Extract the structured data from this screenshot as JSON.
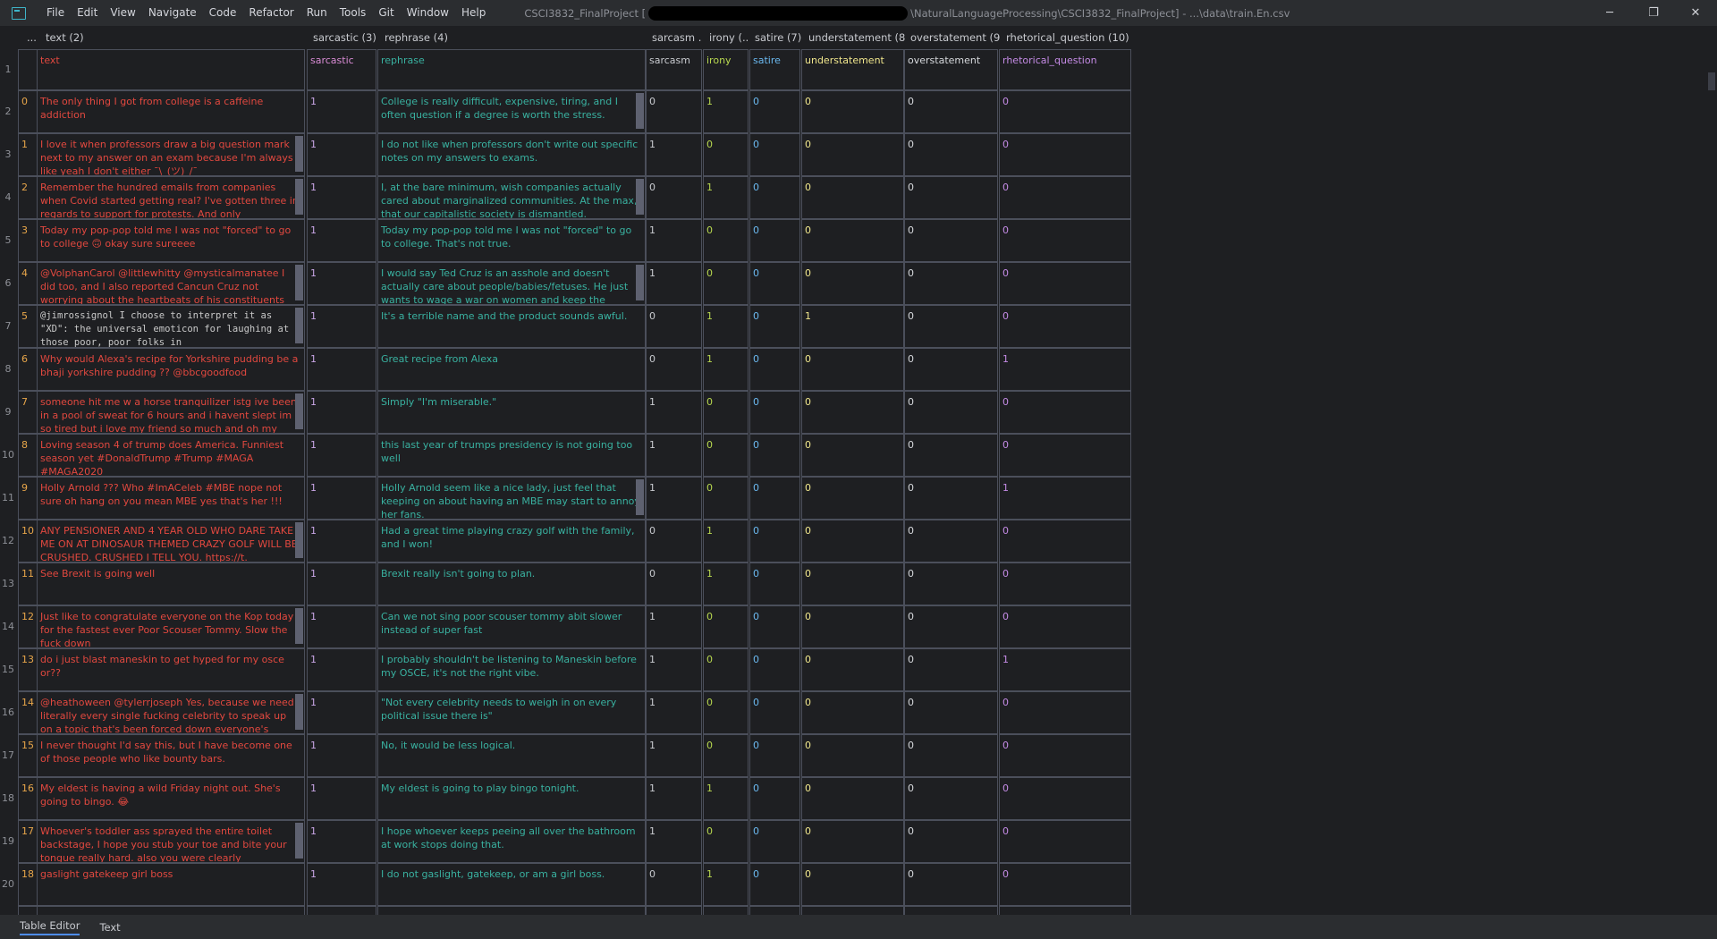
{
  "title": {
    "project": "CSCI3832_FinalProject [",
    "path_tail": "\\NaturalLanguageProcessing\\CSCI3832_FinalProject] - ...\\data\\train.En.csv"
  },
  "menu": [
    "File",
    "Edit",
    "View",
    "Navigate",
    "Code",
    "Refactor",
    "Run",
    "Tools",
    "Git",
    "Window",
    "Help"
  ],
  "window_controls": {
    "minimize": "─",
    "restore": "❐",
    "close": "✕"
  },
  "columns": {
    "corner": "...",
    "text": "text (2)",
    "sarcastic": "sarcastic (3)",
    "rephrase": "rephrase (4)",
    "sarcasm": "sarcasm ...",
    "irony": "irony (...",
    "satire": "satire (7)",
    "understatement": "understatement (8)",
    "overstatement": "overstatement (9)",
    "rhetorical_question": "rhetorical_question (10)"
  },
  "header_row": {
    "rownum": "1",
    "text": "text",
    "sarcastic": "sarcastic",
    "rephrase": "rephrase",
    "sarcasm": "sarcasm",
    "irony": "irony",
    "satire": "satire",
    "understatement": "understatement",
    "overstatement": "overstatement",
    "rhetorical_question": "rhetorical_question"
  },
  "rows": [
    {
      "rownum": "2",
      "idx": "0",
      "text": "The only thing I got from college is a caffeine addiction",
      "sarcastic": "1",
      "rephrase": "College is really difficult, expensive, tiring, and I often question if a degree is worth the stress.",
      "sarcasm": "0",
      "irony": "1",
      "satire": "0",
      "understatement": "0",
      "overstatement": "0",
      "rhetorical_question": "0"
    },
    {
      "rownum": "3",
      "idx": "1",
      "text": "I love it when professors draw a big question mark next to my answer on an exam because I'm always like yeah I don't either ¯\\_(ツ)_/¯",
      "sarcastic": "1",
      "rephrase": "I do not like when professors don't write out specific notes on my answers to exams.",
      "sarcasm": "1",
      "irony": "0",
      "satire": "0",
      "understatement": "0",
      "overstatement": "0",
      "rhetorical_question": "0"
    },
    {
      "rownum": "4",
      "idx": "2",
      "text": "Remember the hundred emails from companies when Covid started getting real? I've gotten three in regards to support for protests. And only",
      "sarcastic": "1",
      "rephrase": "I, at the bare minimum, wish companies actually cared about marginalized communities. At the max, that our capitalistic society is dismantled.",
      "sarcasm": "0",
      "irony": "1",
      "satire": "0",
      "understatement": "0",
      "overstatement": "0",
      "rhetorical_question": "0"
    },
    {
      "rownum": "5",
      "idx": "3",
      "text": "Today my pop-pop told me I was not \"forced\" to go to college 🙃 okay sure sureeee",
      "sarcastic": "1",
      "rephrase": "Today my pop-pop told me I was not \"forced\" to go to college. That's not true.",
      "sarcasm": "1",
      "irony": "0",
      "satire": "0",
      "understatement": "0",
      "overstatement": "0",
      "rhetorical_question": "0"
    },
    {
      "rownum": "6",
      "idx": "4",
      "text": "@VolphanCarol @littlewhitty @mysticalmanatee I did too, and I also reported Cancun Cruz not worrying about the heartbeats of his constituents",
      "sarcastic": "1",
      "rephrase": "I would say Ted Cruz is an asshole and doesn't actually care about people/babies/fetuses. He just wants to wage a war on women and keep the",
      "sarcasm": "1",
      "irony": "0",
      "satire": "0",
      "understatement": "0",
      "overstatement": "0",
      "rhetorical_question": "0"
    },
    {
      "rownum": "7",
      "idx": "5",
      "text": "@jimrossignol I choose to interpret it as \"XD\": the universal emoticon for laughing at those poor, poor folks in",
      "mono": true,
      "sarcastic": "1",
      "rephrase": "It's a terrible name and the product sounds awful.",
      "sarcasm": "0",
      "irony": "1",
      "satire": "0",
      "understatement": "1",
      "overstatement": "0",
      "rhetorical_question": "0"
    },
    {
      "rownum": "8",
      "idx": "6",
      "text": "Why would Alexa's recipe for Yorkshire pudding be a bhaji yorkshire pudding ?? @bbcgoodfood",
      "sarcastic": "1",
      "rephrase": "Great recipe from Alexa",
      "sarcasm": "0",
      "irony": "1",
      "satire": "0",
      "understatement": "0",
      "overstatement": "0",
      "rhetorical_question": "1"
    },
    {
      "rownum": "9",
      "idx": "7",
      "text": "someone hit me w a horse tranquilizer istg ive been in a pool of sweat for 6 hours and i havent slept im so tired but i love my friend so much and oh my",
      "sarcastic": "1",
      "rephrase": "Simply \"I'm miserable.\"",
      "sarcasm": "1",
      "irony": "0",
      "satire": "0",
      "understatement": "0",
      "overstatement": "0",
      "rhetorical_question": "0"
    },
    {
      "rownum": "10",
      "idx": "8",
      "text": "Loving season 4 of trump does America. Funniest season yet #DonaldTrump #Trump #MAGA #MAGA2020",
      "sarcastic": "1",
      "rephrase": "this last year of trumps presidency is not going too well",
      "sarcasm": "1",
      "irony": "0",
      "satire": "0",
      "understatement": "0",
      "overstatement": "0",
      "rhetorical_question": "0"
    },
    {
      "rownum": "11",
      "idx": "9",
      "text": "Holly Arnold ??? Who #ImACeleb  #MBE nope not sure oh hang on you mean MBE yes that's her !!!",
      "sarcastic": "1",
      "rephrase": "Holly Arnold seem like a nice lady, just feel that keeping on about having an MBE may start to annoy her fans.",
      "sarcasm": "1",
      "irony": "0",
      "satire": "0",
      "understatement": "0",
      "overstatement": "0",
      "rhetorical_question": "1"
    },
    {
      "rownum": "12",
      "idx": "10",
      "text": "ANY PENSIONER AND 4 YEAR OLD WHO DARE TAKE ME ON AT DINOSAUR THEMED CRAZY GOLF WILL BE CRUSHED. CRUSHED I TELL YOU. https://t.",
      "sarcastic": "1",
      "rephrase": "Had a great time playing crazy golf with the family, and I won!",
      "sarcasm": "0",
      "irony": "1",
      "satire": "0",
      "understatement": "0",
      "overstatement": "0",
      "rhetorical_question": "0"
    },
    {
      "rownum": "13",
      "idx": "11",
      "text": "See Brexit is going well",
      "sarcastic": "1",
      "rephrase": "Brexit really isn't going to plan.",
      "sarcasm": "0",
      "irony": "1",
      "satire": "0",
      "understatement": "0",
      "overstatement": "0",
      "rhetorical_question": "0"
    },
    {
      "rownum": "14",
      "idx": "12",
      "text": "Just like to congratulate everyone on the Kop today for the fastest ever Poor Scouser Tommy. Slow the fuck down",
      "sarcastic": "1",
      "rephrase": "Can we not sing poor scouser tommy abit slower instead of super fast",
      "sarcasm": "1",
      "irony": "0",
      "satire": "0",
      "understatement": "0",
      "overstatement": "0",
      "rhetorical_question": "0"
    },
    {
      "rownum": "15",
      "idx": "13",
      "text": "do i just blast maneskin to get hyped for my osce or??",
      "sarcastic": "1",
      "rephrase": "I probably shouldn't be listening to Maneskin before my OSCE, it's not the right vibe.",
      "sarcasm": "1",
      "irony": "0",
      "satire": "0",
      "understatement": "0",
      "overstatement": "0",
      "rhetorical_question": "1"
    },
    {
      "rownum": "16",
      "idx": "14",
      "text": "@heathoween @tylerrjoseph Yes, because we need literally every single fucking celebrity to speak up on a topic that's been forced down everyone's throats",
      "sarcastic": "1",
      "rephrase": "\"Not every celebrity needs to weigh in on every political issue there is\"",
      "sarcasm": "1",
      "irony": "0",
      "satire": "0",
      "understatement": "0",
      "overstatement": "0",
      "rhetorical_question": "0"
    },
    {
      "rownum": "17",
      "idx": "15",
      "text": "I never thought I'd say this, but I have become one of those people who like bounty bars.",
      "sarcastic": "1",
      "rephrase": "No, it would be less logical.",
      "sarcasm": "1",
      "irony": "0",
      "satire": "0",
      "understatement": "0",
      "overstatement": "0",
      "rhetorical_question": "0"
    },
    {
      "rownum": "18",
      "idx": "16",
      "text": "My eldest is having a wild Friday night out. She's going to bingo. 😂",
      "sarcastic": "1",
      "rephrase": "My eldest is going to play bingo tonight.",
      "sarcasm": "1",
      "irony": "1",
      "satire": "0",
      "understatement": "0",
      "overstatement": "0",
      "rhetorical_question": "0"
    },
    {
      "rownum": "19",
      "idx": "17",
      "text": "Whoever's toddler ass sprayed the entire toilet backstage, I hope you stub your toe and bite your tongue really hard. also you were clearly",
      "sarcastic": "1",
      "rephrase": "I hope whoever keeps peeing all over the bathroom at work stops doing that.",
      "sarcasm": "1",
      "irony": "0",
      "satire": "0",
      "understatement": "0",
      "overstatement": "0",
      "rhetorical_question": "0"
    },
    {
      "rownum": "20",
      "idx": "18",
      "text": "gaslight gatekeep girl boss",
      "sarcastic": "1",
      "rephrase": "I do not gaslight, gatekeep, or am a girl boss.",
      "sarcasm": "0",
      "irony": "1",
      "satire": "0",
      "understatement": "0",
      "overstatement": "0",
      "rhetorical_question": "0"
    }
  ],
  "bottom_tabs": [
    "Table Editor",
    "Text"
  ],
  "colors": {
    "background": "#1e1f22",
    "text_col": "#e1483f",
    "rephrase_col": "#39b1a0",
    "index_col": "#e8a64a",
    "grid_border": "#4b4f5b"
  }
}
